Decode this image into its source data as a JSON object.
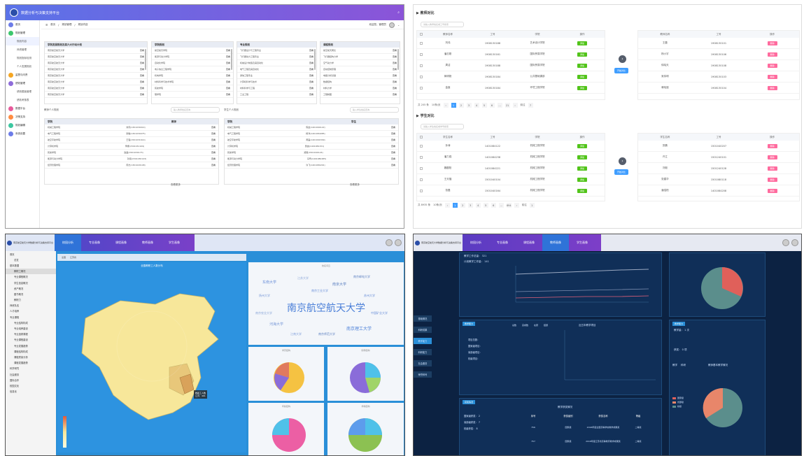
{
  "p1": {
    "title": "数据分析与决策支持平台",
    "breadcrumb": [
      "首页",
      "规划管理",
      "规划内容"
    ],
    "user": "欢迎您，管理员",
    "side": [
      {
        "label": "首页",
        "color": "#6c7ce8",
        "sub": false
      },
      {
        "label": "规划管理",
        "color": "#3cc76d",
        "sub": false
      },
      {
        "label": "规划内容",
        "sub": true,
        "active": true
      },
      {
        "label": "师资管理",
        "sub": true
      },
      {
        "label": "规划指标检测",
        "sub": true
      },
      {
        "label": "个人发展规划",
        "sub": true
      },
      {
        "label": "监督与问责",
        "color": "#f5a623",
        "sub": false
      },
      {
        "label": "绩效管理",
        "color": "#8e6cd9",
        "sub": false
      },
      {
        "label": "绩效模板管理",
        "sub": true
      },
      {
        "label": "绩效考核表",
        "sub": true
      },
      {
        "label": "数据平台",
        "color": "#e85a9b",
        "sub": false
      },
      {
        "label": "决策支持",
        "color": "#ff8c42",
        "sub": false
      },
      {
        "label": "规划编辑",
        "color": "#3cc7a0",
        "sub": false
      },
      {
        "label": "系统设置",
        "color": "#6c7ce8",
        "sub": false
      }
    ],
    "cols": [
      {
        "head": "学院发展规划及其六大行动计划",
        "rows": [
          "南京航空航天大学"
        ]
      },
      {
        "head": "学院规划",
        "rows": [
          "航空航天学院",
          "能源与动力学院",
          "自动化学院",
          "电子信息工程学院",
          "机电学院",
          "材料科学与技术学院",
          "民航学院",
          "理学院"
        ]
      },
      {
        "head": "专业规划",
        "rows": [
          "飞行器设计与工程专业",
          "飞行器动力工程专业",
          "机械设计制造及其自动化",
          "电气工程及其自动化",
          "通信工程专业",
          "计算机科学与技术",
          "材料科学与工程",
          "工业工程"
        ]
      },
      {
        "head": "课程规划",
        "rows": [
          "航空航天概论",
          "飞行器结构力学",
          "空气动力学",
          "自动控制原理",
          "电路分析基础",
          "数据结构",
          "材料力学",
          "工程制图"
        ]
      }
    ],
    "view_label": "查看",
    "teacher_title": "教师个人规划",
    "student_title": "学生个人规划",
    "teacher_search": "输入教师姓名查询",
    "student_search": "输入学生姓名查询",
    "tcols": [
      "学院",
      "教师"
    ],
    "trows": [
      [
        "机械工程学院",
        "刘伟(1301030014)"
      ],
      [
        "电气工程学院",
        "张敏(1301030075)"
      ],
      [
        "航空宇航学院",
        "王强(1501031614)"
      ],
      [
        "计算机学院",
        "李娜(1501031109)"
      ],
      [
        "民航学院",
        "赵磊(1501030173)"
      ],
      [
        "能源与动力学院",
        "孙丽(1501030143)"
      ],
      [
        "经济管理学院",
        "周杰(1301020148)"
      ]
    ],
    "scols": [
      "学院",
      "学生"
    ],
    "srows": [
      [
        "机械工程学院",
        "陈晨(1401090122)"
      ],
      [
        "电气工程学院",
        "杨洋(1401084085)"
      ],
      [
        "航空宇航学院",
        "黄磊(1401090309)"
      ],
      [
        "计算机学院",
        "吴迪(1401084151)"
      ],
      [
        "民航学院",
        "郑爽(1501040124)"
      ],
      [
        "能源与动力学院",
        "冯雪(1401080485)"
      ],
      [
        "经济管理学院",
        "许飞(1401080291)"
      ]
    ],
    "more_label": "查看更多"
  },
  "p2": {
    "teacher_title": "教师对比",
    "student_title": "学生对比",
    "teacher_search": "请输入教师姓名或工号搜索",
    "student_search": "请输入学生姓名或学号搜索",
    "t_head": [
      "教师名称",
      "工号",
      "学院",
      "操作"
    ],
    "t_rows": [
      [
        "刘伟",
        "1908130188",
        "艺术设计学院"
      ],
      [
        "潘志刚",
        "1908130161",
        "国际贸易学院"
      ],
      [
        "周洁",
        "1908130188",
        "国际贸易学院"
      ],
      [
        "蒋明艳",
        "1908130184",
        "公共基础课部"
      ],
      [
        "金鑫",
        "1908130184",
        "环境工程学院"
      ]
    ],
    "t_right_head": [
      "教师名称",
      "工号",
      "操作"
    ],
    "t_right_rows": [
      [
        "王磊",
        "1908130101"
      ],
      [
        "杨小宇",
        "1908130106"
      ],
      [
        "徐晓天",
        "1908130108"
      ],
      [
        "吴伟明",
        "1908130103"
      ],
      [
        "蒋晓娅",
        "1908130104"
      ]
    ],
    "s_head": [
      "学生名称",
      "工号",
      "学院",
      "操作"
    ],
    "s_rows": [
      [
        "孙涛",
        "1401084122",
        "机械工程学院"
      ],
      [
        "潘力强",
        "1401084238",
        "机械工程学院"
      ],
      [
        "魏晨阳",
        "1401084221",
        "机械工程学院"
      ],
      [
        "王天福",
        "1501040104",
        "机械工程学院"
      ],
      [
        "张磊",
        "1501040164",
        "机械工程学院"
      ]
    ],
    "s_right_head": [
      "学生名称",
      "工号",
      "操作"
    ],
    "s_right_rows": [
      [
        "张鹏",
        "1501040207"
      ],
      [
        "许立",
        "1501240101"
      ],
      [
        "刘毅",
        "1501240128"
      ],
      [
        "张建华",
        "1501080118"
      ],
      [
        "潘浩阳",
        "1401084208"
      ]
    ],
    "add_label": "添加",
    "del_label": "删除",
    "compare_label": "开始对比",
    "t_total": "共 205 条",
    "t_pagesize": "10条/页",
    "t_pages": [
      "1",
      "2",
      "3",
      "4",
      "5",
      "6",
      "...",
      "21"
    ],
    "t_goto": "前往",
    "t_goto_val": "7",
    "s_total": "共 8935 条",
    "s_pagesize": "10条/页",
    "s_pages": [
      "1",
      "2",
      "3",
      "4",
      "5",
      "6",
      "...",
      "894"
    ],
    "s_goto": "前往",
    "s_goto_val": "1"
  },
  "p3": {
    "title": "南京航空航天大学数据分析与决策支持平台",
    "tabs": [
      "校园分析",
      "专业画像",
      "课程画像",
      "教师画像",
      "学生画像"
    ],
    "active_tab": 0,
    "side": [
      {
        "label": "首页"
      },
      {
        "label": "总览",
        "sub": true
      },
      {
        "label": "基本数据"
      },
      {
        "label": "教职工概况",
        "sub": true,
        "on": true
      },
      {
        "label": "专业课程概况",
        "sub": true
      },
      {
        "label": "学生信息概况",
        "sub": true
      },
      {
        "label": "资产概况",
        "sub": true
      },
      {
        "label": "图书概况",
        "sub": true
      },
      {
        "label": "教职力",
        "sub": true
      },
      {
        "label": "师资队伍"
      },
      {
        "label": "人才培养"
      },
      {
        "label": "专业课程"
      },
      {
        "label": "专业结构构成",
        "sub": true
      },
      {
        "label": "专业培养建设",
        "sub": true
      },
      {
        "label": "专业选修课程",
        "sub": true
      },
      {
        "label": "专业课程建设",
        "sub": true
      },
      {
        "label": "专业发展趋势",
        "sub": true
      },
      {
        "label": "课程结构构成",
        "sub": true
      },
      {
        "label": "课程质量分析",
        "sub": true
      },
      {
        "label": "课程发展趋势",
        "sub": true
      },
      {
        "label": "科学研究"
      },
      {
        "label": "社会服务"
      },
      {
        "label": "国际合作"
      },
      {
        "label": "校园文化"
      },
      {
        "label": "信息化"
      }
    ],
    "map_title": "全国教职工人数分布",
    "map_tabs": [
      "全国",
      "江苏省"
    ],
    "tooltip_name": "教职工人数",
    "tooltip_val": "江苏：491",
    "cloud_title": "校名词云",
    "cloud_words": [
      "南京航空航天大学",
      "东南大学",
      "南京大学",
      "河海大学",
      "南京理工大学",
      "江苏大学",
      "苏州大学",
      "扬州大学",
      "南京师范大学",
      "中国矿业大学",
      "南京农业大学",
      "江南大学",
      "南京邮电大学",
      "南京工业大学"
    ],
    "pie_titles": [
      "学历结构",
      "职称结构",
      "年龄结构",
      "学缘结构"
    ]
  },
  "p4": {
    "title": "南京航空航天大学数据分析与决策支持平台",
    "tabs": [
      "校园分析",
      "专业画像",
      "课程画像",
      "教师画像",
      "学生画像"
    ],
    "active_tab": 3,
    "left_tabs": [
      "基础概况",
      "科研成果",
      "教学能力",
      "科研能力",
      "社会服务",
      "荣誉称号"
    ],
    "left_active": 2,
    "stats": {
      "line1": "教学工作总量： 321",
      "line2": "计划教学工作量： 141"
    },
    "teach_tag": "教学能力",
    "teach_header": [
      "总数",
      "完成数",
      "在研",
      "结题"
    ],
    "teach_title": "近五年教学项目",
    "project_labels": [
      "项目总数：",
      "国家级项目：",
      "省部级项目：",
      "校级项目："
    ],
    "award_tag": "获奖情况",
    "award_lines": [
      "国家级获奖： 2",
      "省部级获奖： 7",
      "校级获奖： 8"
    ],
    "award_title": "教学获奖情况",
    "award_head": [
      "序号",
      "获奖级别",
      "获奖名称",
      "等级"
    ],
    "award_rows": [
      [
        "756",
        "国家级",
        "2018年度全国高等学校教学成果奖",
        "二等奖"
      ],
      [
        "757",
        "国家级",
        "2018年度江苏省高等教育教学成果奖",
        "二等奖"
      ]
    ],
    "right_tag": "教学能力",
    "right_stats": [
      "教学量： 1 次",
      "获奖： 0 项"
    ],
    "right_sub": [
      "教学",
      "科研"
    ],
    "right_chart_title": "教师基本教学情况",
    "legend": [
      "国家级",
      "省部级",
      "校级"
    ]
  }
}
